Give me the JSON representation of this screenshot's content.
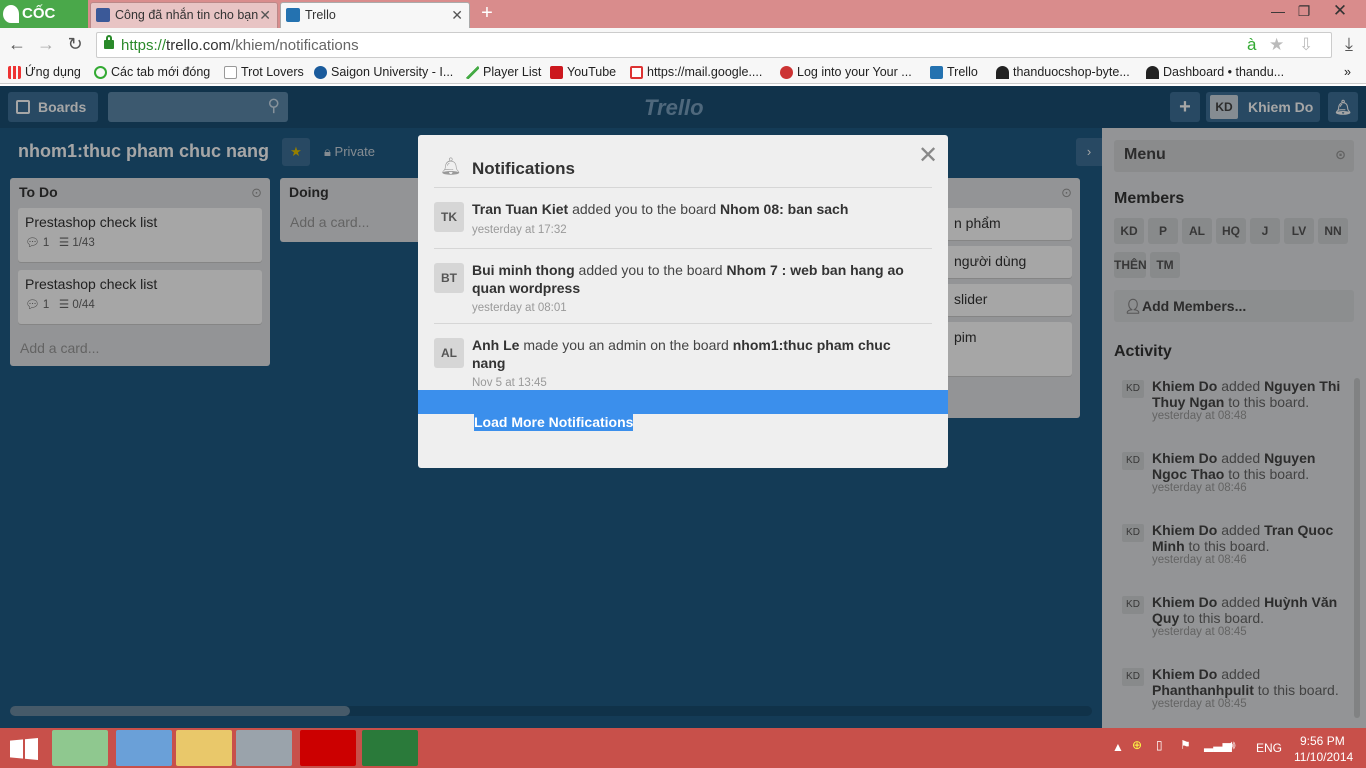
{
  "browser": {
    "logo": "CỐC CỐC",
    "tabs": [
      {
        "title": "Công đã nhắn tin cho bạn",
        "active": false
      },
      {
        "title": "Trello",
        "active": true
      }
    ],
    "new_tab": "+",
    "url_scheme": "https://",
    "url_host": "trello.com",
    "url_path": "/khiem/notifications",
    "bookmarks": [
      "Ứng dụng",
      "Các tab mới đóng",
      "Trot Lovers",
      "Saigon University - I...",
      "Player List",
      "YouTube",
      "https://mail.google....",
      "Log into your Your ...",
      "Trello",
      "thanduocshop-byte...",
      "Dashboard • thandu..."
    ],
    "more": "»"
  },
  "header": {
    "boards_label": "Boards",
    "logo": "Trello",
    "user_initials": "KD",
    "user_name": "Khiem Do",
    "add": "+"
  },
  "board": {
    "title": "nhom1:thuc pham chuc nang",
    "visibility": "Private"
  },
  "lists": [
    {
      "title": "To Do",
      "cards": [
        {
          "title": "Prestashop check list",
          "comments": "1",
          "checklist": "1/43"
        },
        {
          "title": "Prestashop check list",
          "comments": "1",
          "checklist": "0/44"
        }
      ],
      "add_card": "Add a card..."
    },
    {
      "title": "Doing",
      "add_card": "Add a card..."
    }
  ],
  "hidden_list_cards": [
    "n phẩm",
    "người dùng",
    "slider",
    "pim"
  ],
  "sidebar": {
    "menu": "Menu",
    "members_title": "Members",
    "members": [
      "KD",
      "P",
      "AL",
      "HQ",
      "J",
      "LV",
      "NN",
      "THÊN",
      "TM"
    ],
    "add_members": "Add Members...",
    "activity_title": "Activity",
    "activity": [
      {
        "avatar": "KD",
        "actor": "Khiem Do",
        "verb": "added",
        "target": "Nguyen Thi Thuy Ngan",
        "rest": "to this board.",
        "time": "yesterday at 08:48"
      },
      {
        "avatar": "KD",
        "actor": "Khiem Do",
        "verb": "added",
        "target": "Nguyen Ngoc Thao",
        "rest": "to this board.",
        "time": "yesterday at 08:46"
      },
      {
        "avatar": "KD",
        "actor": "Khiem Do",
        "verb": "added",
        "target": "Tran Quoc Minh",
        "rest": "to this board.",
        "time": "yesterday at 08:46"
      },
      {
        "avatar": "KD",
        "actor": "Khiem Do",
        "verb": "added",
        "target": "Huỳnh Văn Quy",
        "rest": "to this board.",
        "time": "yesterday at 08:45"
      },
      {
        "avatar": "KD",
        "actor": "Khiem Do",
        "verb": "added",
        "target": "Phanthanhpulit",
        "rest": "to this board.",
        "time": "yesterday at 08:45"
      }
    ]
  },
  "modal": {
    "title": "Notifications",
    "close": "✕",
    "notifications": [
      {
        "avatar": "TK",
        "actor": "Tran Tuan Kiet",
        "verb": "added you to the board",
        "board": "Nhom 08: ban sach",
        "time": "yesterday at 17:32"
      },
      {
        "avatar": "BT",
        "actor": "Bui minh thong",
        "verb": "added you to the board",
        "board": "Nhom 7 : web ban hang ao quan wordpress",
        "time": "yesterday at 08:01"
      },
      {
        "avatar": "AL",
        "actor": "Anh Le",
        "verb": "made you an admin on the board",
        "board": "nhom1:thuc pham chuc nang",
        "time": "Nov 5 at 13:45"
      }
    ],
    "load_more": "Load More Notifications"
  },
  "taskbar": {
    "language": "ENG",
    "time": "9:56 PM",
    "date": "11/10/2014"
  },
  "colors": {
    "board_bg": "#1f5b84",
    "header_bg": "#1b4f74",
    "accent_blue": "#3b8fec",
    "taskbar": "#c8504a"
  }
}
